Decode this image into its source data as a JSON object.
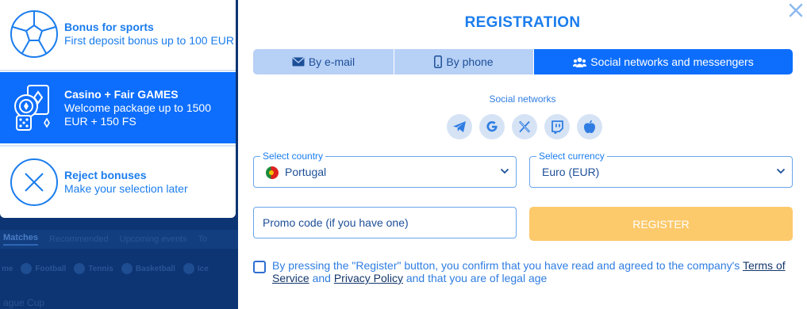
{
  "background": {
    "nav": [
      "Matches",
      "Recommended",
      "Upcoming events",
      "To"
    ],
    "sports": [
      "me",
      "Football",
      "Tennis",
      "Basketball",
      "Ice"
    ],
    "league": "ague Cup"
  },
  "bonuses": [
    {
      "icon": "soccer-ball-icon",
      "title": "Bonus for sports",
      "desc": "First deposit bonus up to 100 EUR"
    },
    {
      "icon": "casino-chips-icon",
      "title": "Casino + Fair GAMES",
      "desc": "Welcome package up to 1500 EUR + 150 FS"
    },
    {
      "icon": "reject-x-icon",
      "title": "Reject bonuses",
      "desc": "Make your selection later"
    }
  ],
  "registration": {
    "title": "REGISTRATION",
    "tabs": [
      {
        "icon": "envelope-icon",
        "label": "By e-mail"
      },
      {
        "icon": "phone-icon",
        "label": "By phone"
      },
      {
        "icon": "users-icon",
        "label": "Social networks and messengers",
        "active": true
      }
    ],
    "social_label": "Social networks",
    "social_icons": [
      "telegram-icon",
      "google-icon",
      "x-icon",
      "twitch-icon",
      "apple-icon"
    ],
    "country": {
      "label": "Select country",
      "value": "Portugal"
    },
    "currency": {
      "label": "Select currency",
      "value": "Euro (EUR)"
    },
    "promo_placeholder": "Promo code (if you have one)",
    "register_label": "REGISTER",
    "agreement": {
      "prefix": "By pressing the \"Register\" button, you confirm that you have read and agreed to the company's",
      "terms_link": "Terms of Service",
      "and": "and",
      "privacy_link": "Privacy Policy",
      "suffix": "and that you are of legal age"
    }
  },
  "colors": {
    "accent": "#0d6efd",
    "text_blue": "#1b7ded",
    "tab_inactive": "#b7d0f6",
    "register_button": "#fcc96b"
  }
}
